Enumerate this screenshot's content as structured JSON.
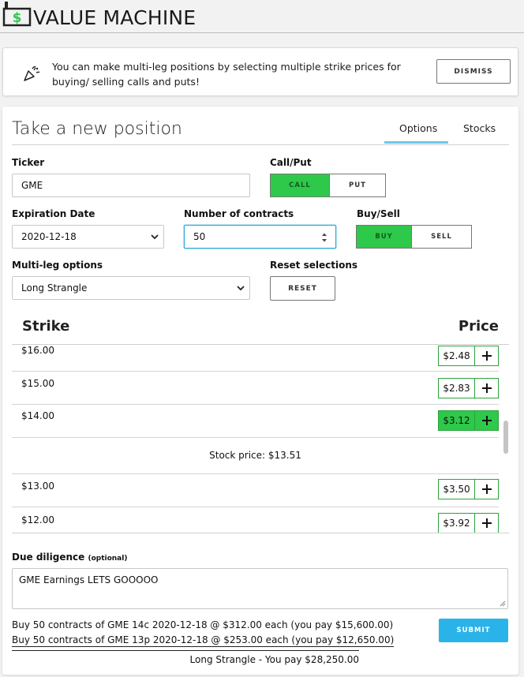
{
  "app": {
    "title": "VALUE MACHINE"
  },
  "notice": {
    "message": "You can make multi-leg positions by selecting multiple strike prices for buying/ selling calls and puts!",
    "dismiss_label": "DISMISS"
  },
  "position": {
    "title": "Take a new position",
    "tabs": [
      {
        "label": "Options",
        "active": true
      },
      {
        "label": "Stocks",
        "active": false
      }
    ],
    "ticker": {
      "label": "Ticker",
      "value": "GME"
    },
    "call_put": {
      "label": "Call/Put",
      "options": [
        "CALL",
        "PUT"
      ],
      "selected": "CALL"
    },
    "expiration": {
      "label": "Expiration Date",
      "value": "2020-12-18"
    },
    "contracts": {
      "label": "Number of contracts",
      "value": "50"
    },
    "buy_sell": {
      "label": "Buy/Sell",
      "options": [
        "BUY",
        "SELL"
      ],
      "selected": "BUY"
    },
    "multileg": {
      "label": "Multi-leg options",
      "value": "Long Strangle"
    },
    "reset": {
      "label": "Reset selections",
      "button": "RESET"
    }
  },
  "table": {
    "headers": {
      "strike": "Strike",
      "price": "Price"
    },
    "rows": [
      {
        "strike": "$16.00",
        "price": "$2.48",
        "selected": false
      },
      {
        "strike": "$15.00",
        "price": "$2.83",
        "selected": false
      },
      {
        "strike": "$14.00",
        "price": "$3.12",
        "selected": true
      },
      {
        "strike": "$13.00",
        "price": "$3.50",
        "selected": false
      },
      {
        "strike": "$12.00",
        "price": "$3.92",
        "selected": false
      }
    ],
    "stock_price": "Stock price: $13.51"
  },
  "due_diligence": {
    "label": "Due diligence",
    "label_note": "(optional)",
    "value": "GME Earnings LETS GOOOOO"
  },
  "summary": {
    "lines": [
      "Buy 50 contracts of GME 14c 2020-12-18 @ $312.00 each (you pay $15,600.00)",
      "Buy 50 contracts of GME 13p 2020-12-18 @ $253.00 each (you pay $12,650.00)"
    ],
    "total": "Long Strangle - You pay $28,250.00",
    "submit_label": "SUBMIT"
  },
  "colors": {
    "accent": "#2ab3e8",
    "buy_green": "#2ec84a",
    "tab_underline": "#6ec6e8"
  }
}
